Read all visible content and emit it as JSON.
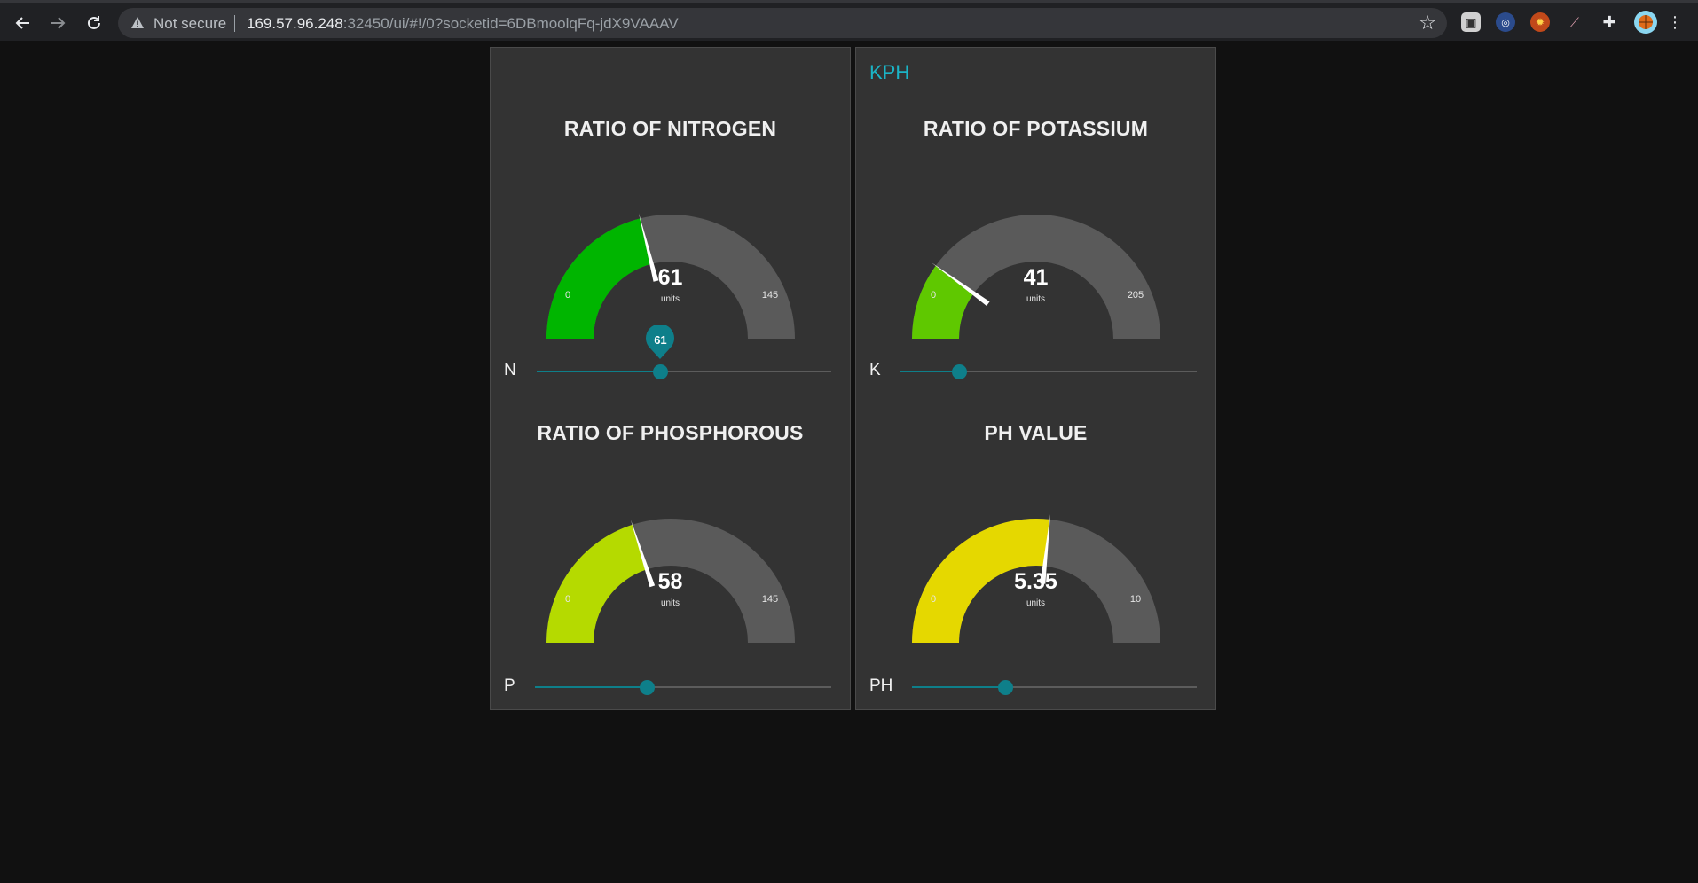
{
  "browser": {
    "not_secure_label": "Not secure",
    "url_host": "169.57.96.248",
    "url_rest": ":32450/ui/#!/0?socketid=6DBmoolqFq-jdX9VAAAV",
    "icons": [
      "back-arrow-icon",
      "forward-arrow-icon",
      "reload-icon",
      "warning-icon",
      "star-icon",
      "extension-icon",
      "puzzle-icon",
      "profile-avatar-icon",
      "menu-dots-icon"
    ]
  },
  "dashboard": {
    "group_title": "KPH",
    "accent_color": "#1bb4c6",
    "slider_color": "#0e7f8a",
    "gauges": {
      "nitrogen": {
        "title": "RATIO OF NITROGEN",
        "value": 61,
        "value_label": "61",
        "units": "units",
        "min": 0,
        "max": 145,
        "min_label": "0",
        "max_label": "145",
        "color": "#00b500"
      },
      "potassium": {
        "title": "RATIO OF POTASSIUM",
        "value": 41,
        "value_label": "41",
        "units": "units",
        "min": 0,
        "max": 205,
        "min_label": "0",
        "max_label": "205",
        "color": "#5fc800"
      },
      "phosphorous": {
        "title": "RATIO OF PHOSPHOROUS",
        "value": 58,
        "value_label": "58",
        "units": "units",
        "min": 0,
        "max": 145,
        "min_label": "0",
        "max_label": "145",
        "color": "#b5da00"
      },
      "ph": {
        "title": "PH VALUE",
        "value": 5.35,
        "value_label": "5.35",
        "units": "units",
        "min": 0,
        "max": 10,
        "min_label": "0",
        "max_label": "10",
        "color": "#e5d800"
      }
    },
    "sliders": {
      "n": {
        "label": "N",
        "fraction": 0.42,
        "pin_value": "61"
      },
      "k": {
        "label": "K",
        "fraction": 0.2
      },
      "p": {
        "label": "P",
        "fraction": 0.38
      },
      "ph": {
        "label": "PH",
        "fraction": 0.33
      }
    }
  }
}
